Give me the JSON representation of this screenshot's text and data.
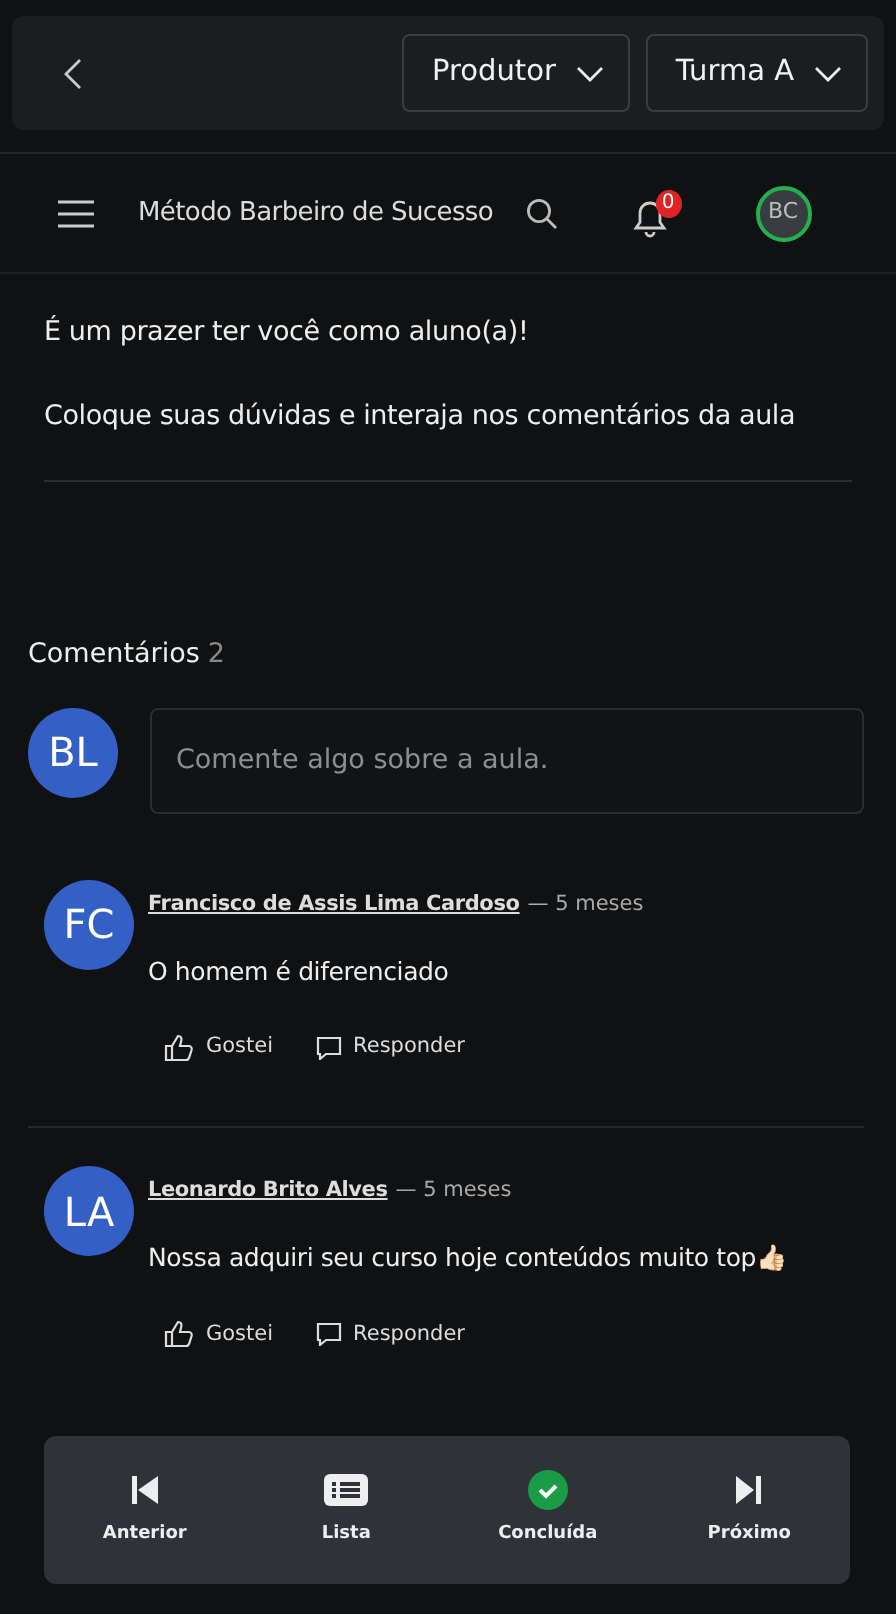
{
  "topbar": {
    "selects": [
      {
        "label": "Produtor"
      },
      {
        "label": "Turma A"
      }
    ]
  },
  "navbar": {
    "title": "Método Barbeiro de Sucesso",
    "notifications": "0",
    "avatar": "BC"
  },
  "content": {
    "paragraphs": [
      "É um prazer ter você como aluno(a)!",
      "Coloque suas dúvidas e interaja nos comentários da aula"
    ]
  },
  "comments_section": {
    "title": "Comentários",
    "count": "2",
    "user_avatar": "BL",
    "placeholder": "Comente algo sobre a aula.",
    "comments": [
      {
        "avatar": "FC",
        "author": "Francisco de Assis Lima Cardoso ",
        "time": "— 5 meses",
        "text": "O homem é diferenciado",
        "like": "Gostei",
        "reply": "Responder"
      },
      {
        "avatar": "LA",
        "author": "Leonardo Brito Alves",
        "time": "— 5 meses",
        "text": "Nossa adquiri seu curso hoje conteúdos muito top👍🏻",
        "like": "Gostei",
        "reply": "Responder"
      }
    ]
  },
  "bottom_nav": [
    {
      "kind": "previous",
      "label": "Anterior"
    },
    {
      "kind": "list",
      "label": "Lista"
    },
    {
      "kind": "done",
      "label": "Concluída"
    },
    {
      "kind": "next",
      "label": "Próximo"
    }
  ]
}
